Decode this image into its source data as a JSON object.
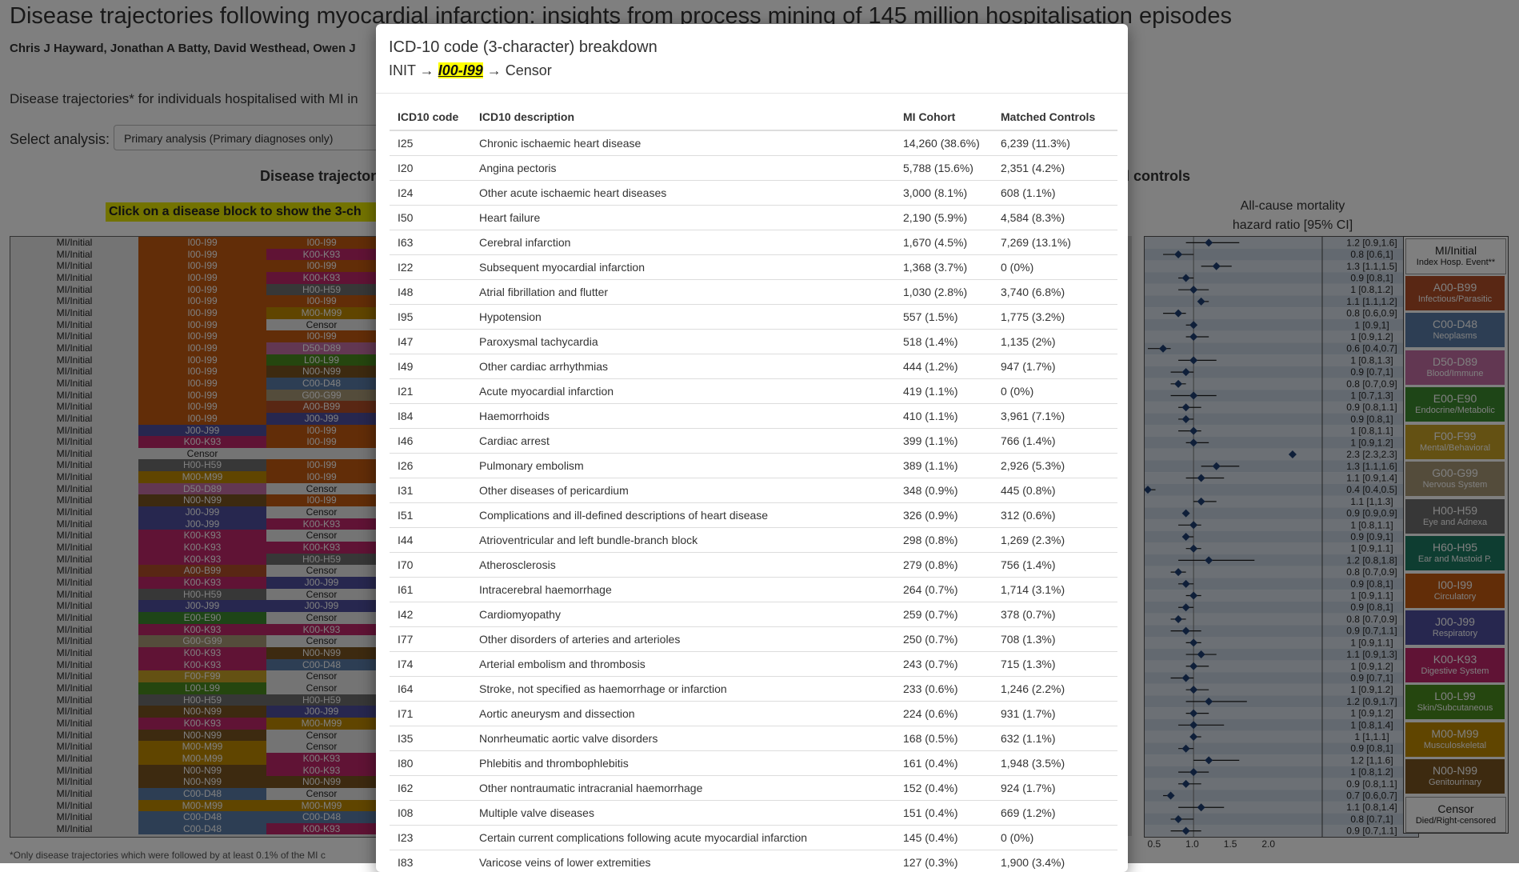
{
  "page": {
    "title": "Disease trajectories following myocardial infarction: insights from process mining of 145 million hospitalisation episodes",
    "authors": "Chris J Hayward, Jonathan A Batty, David Westhead, Owen J",
    "intro": "Disease trajectories* for individuals hospitalised with MI in",
    "select_label": "Select analysis:",
    "select_value": "Primary analysis (Primary diagnoses only)",
    "section_left": "Disease trajector",
    "section_right": "ched controls",
    "click_banner": "Click on a disease block to show the 3-ch",
    "footnote": "*Only disease trajectories which were followed by at least 0.1% of the MI c",
    "hr_title_line1": "All-cause mortality",
    "hr_title_line2": "hazard ratio [95% CI]",
    "axis_ticks": [
      "0.5",
      "1.0",
      "1.5",
      "2.0"
    ]
  },
  "colors": {
    "A00-B99": "#b34f28",
    "C00-D48": "#5a7ca8",
    "D50-D89": "#c46fa4",
    "E00-E90": "#3c8a2e",
    "F00-F99": "#c9a326",
    "G00-G99": "#a89877",
    "H00-H59": "#6e6e6e",
    "H60-H95": "#1d7a63",
    "I00-I99": "#c55a11",
    "J00-J99": "#4f4f9e",
    "K00-K93": "#c0266a",
    "L00-L99": "#4b8c1f",
    "M00-M99": "#c08a00",
    "N00-N99": "#7a5520",
    "Censor": "#e8e8e8"
  },
  "trajectories": [
    [
      "MI/Initial",
      "I00-I99",
      "I00-I99"
    ],
    [
      "MI/Initial",
      "I00-I99",
      "K00-K93"
    ],
    [
      "MI/Initial",
      "I00-I99",
      "I00-I99"
    ],
    [
      "MI/Initial",
      "I00-I99",
      "K00-K93"
    ],
    [
      "MI/Initial",
      "I00-I99",
      "H00-H59"
    ],
    [
      "MI/Initial",
      "I00-I99",
      "I00-I99"
    ],
    [
      "MI/Initial",
      "I00-I99",
      "M00-M99"
    ],
    [
      "MI/Initial",
      "I00-I99",
      "Censor"
    ],
    [
      "MI/Initial",
      "I00-I99",
      "I00-I99"
    ],
    [
      "MI/Initial",
      "I00-I99",
      "D50-D89"
    ],
    [
      "MI/Initial",
      "I00-I99",
      "L00-L99"
    ],
    [
      "MI/Initial",
      "I00-I99",
      "N00-N99"
    ],
    [
      "MI/Initial",
      "I00-I99",
      "C00-D48"
    ],
    [
      "MI/Initial",
      "I00-I99",
      "G00-G99"
    ],
    [
      "MI/Initial",
      "I00-I99",
      "A00-B99"
    ],
    [
      "MI/Initial",
      "I00-I99",
      "J00-J99"
    ],
    [
      "MI/Initial",
      "J00-J99",
      "I00-I99"
    ],
    [
      "MI/Initial",
      "K00-K93",
      "I00-I99"
    ],
    [
      "MI/Initial",
      "Censor",
      ""
    ],
    [
      "MI/Initial",
      "H00-H59",
      "I00-I99"
    ],
    [
      "MI/Initial",
      "M00-M99",
      "I00-I99"
    ],
    [
      "MI/Initial",
      "D50-D89",
      "Censor"
    ],
    [
      "MI/Initial",
      "N00-N99",
      "I00-I99"
    ],
    [
      "MI/Initial",
      "J00-J99",
      "Censor"
    ],
    [
      "MI/Initial",
      "J00-J99",
      "K00-K93"
    ],
    [
      "MI/Initial",
      "K00-K93",
      "Censor"
    ],
    [
      "MI/Initial",
      "K00-K93",
      "K00-K93"
    ],
    [
      "MI/Initial",
      "K00-K93",
      "H00-H59"
    ],
    [
      "MI/Initial",
      "A00-B99",
      "Censor"
    ],
    [
      "MI/Initial",
      "K00-K93",
      "J00-J99"
    ],
    [
      "MI/Initial",
      "H00-H59",
      "Censor"
    ],
    [
      "MI/Initial",
      "J00-J99",
      "J00-J99"
    ],
    [
      "MI/Initial",
      "E00-E90",
      "Censor"
    ],
    [
      "MI/Initial",
      "K00-K93",
      "K00-K93"
    ],
    [
      "MI/Initial",
      "G00-G99",
      "Censor"
    ],
    [
      "MI/Initial",
      "K00-K93",
      "N00-N99"
    ],
    [
      "MI/Initial",
      "K00-K93",
      "C00-D48"
    ],
    [
      "MI/Initial",
      "F00-F99",
      "Censor"
    ],
    [
      "MI/Initial",
      "L00-L99",
      "Censor"
    ],
    [
      "MI/Initial",
      "H00-H59",
      "H00-H59"
    ],
    [
      "MI/Initial",
      "N00-N99",
      "J00-J99"
    ],
    [
      "MI/Initial",
      "K00-K93",
      "M00-M99"
    ],
    [
      "MI/Initial",
      "N00-N99",
      "Censor"
    ],
    [
      "MI/Initial",
      "M00-M99",
      "Censor"
    ],
    [
      "MI/Initial",
      "M00-M99",
      "K00-K93"
    ],
    [
      "MI/Initial",
      "N00-N99",
      "K00-K93"
    ],
    [
      "MI/Initial",
      "N00-N99",
      "N00-N99"
    ],
    [
      "MI/Initial",
      "C00-D48",
      "Censor"
    ],
    [
      "MI/Initial",
      "M00-M99",
      "M00-M99"
    ],
    [
      "MI/Initial",
      "C00-D48",
      "C00-D48"
    ],
    [
      "MI/Initial",
      "C00-D48",
      "K00-K93"
    ]
  ],
  "hazard_ratios": [
    {
      "label": "1.2 [0.9,1.6]",
      "est": 1.2,
      "lo": 0.9,
      "hi": 1.6
    },
    {
      "label": "0.8 [0.6,1]",
      "est": 0.8,
      "lo": 0.6,
      "hi": 1.0
    },
    {
      "label": "1.3 [1.1,1.5]",
      "est": 1.3,
      "lo": 1.1,
      "hi": 1.5
    },
    {
      "label": "0.9 [0.8,1]",
      "est": 0.9,
      "lo": 0.8,
      "hi": 1.0
    },
    {
      "label": "1 [0.8,1.2]",
      "est": 1.0,
      "lo": 0.8,
      "hi": 1.2
    },
    {
      "label": "1.1 [1.1,1.2]",
      "est": 1.1,
      "lo": 1.1,
      "hi": 1.2
    },
    {
      "label": "0.8 [0.6,0.9]",
      "est": 0.8,
      "lo": 0.6,
      "hi": 0.9
    },
    {
      "label": "1 [0.9,1]",
      "est": 1.0,
      "lo": 0.9,
      "hi": 1.0
    },
    {
      "label": "1 [0.9,1.2]",
      "est": 1.0,
      "lo": 0.9,
      "hi": 1.2
    },
    {
      "label": "0.6 [0.4,0.7]",
      "est": 0.6,
      "lo": 0.4,
      "hi": 0.7
    },
    {
      "label": "1 [0.8,1.3]",
      "est": 1.0,
      "lo": 0.8,
      "hi": 1.3
    },
    {
      "label": "0.9 [0.7,1]",
      "est": 0.9,
      "lo": 0.7,
      "hi": 1.0
    },
    {
      "label": "0.8 [0.7,0.9]",
      "est": 0.8,
      "lo": 0.7,
      "hi": 0.9
    },
    {
      "label": "1 [0.7,1.3]",
      "est": 1.0,
      "lo": 0.7,
      "hi": 1.3
    },
    {
      "label": "0.9 [0.8,1.1]",
      "est": 0.9,
      "lo": 0.8,
      "hi": 1.1
    },
    {
      "label": "0.9 [0.8,1]",
      "est": 0.9,
      "lo": 0.8,
      "hi": 1.0
    },
    {
      "label": "1 [0.8,1.1]",
      "est": 1.0,
      "lo": 0.8,
      "hi": 1.1
    },
    {
      "label": "1 [0.9,1.2]",
      "est": 1.0,
      "lo": 0.9,
      "hi": 1.2
    },
    {
      "label": "2.3 [2.3,2.3]",
      "est": 2.3,
      "lo": 2.3,
      "hi": 2.3
    },
    {
      "label": "1.3 [1.1,1.6]",
      "est": 1.3,
      "lo": 1.1,
      "hi": 1.6
    },
    {
      "label": "1.1 [0.9,1.4]",
      "est": 1.1,
      "lo": 0.9,
      "hi": 1.4
    },
    {
      "label": "0.4 [0.4,0.5]",
      "est": 0.4,
      "lo": 0.4,
      "hi": 0.5
    },
    {
      "label": "1.1 [1,1.3]",
      "est": 1.1,
      "lo": 1.0,
      "hi": 1.3
    },
    {
      "label": "0.9 [0.9,0.9]",
      "est": 0.9,
      "lo": 0.9,
      "hi": 0.9
    },
    {
      "label": "1 [0.8,1.1]",
      "est": 1.0,
      "lo": 0.8,
      "hi": 1.1
    },
    {
      "label": "0.9 [0.9,1]",
      "est": 0.9,
      "lo": 0.9,
      "hi": 1.0
    },
    {
      "label": "1 [0.9,1.1]",
      "est": 1.0,
      "lo": 0.9,
      "hi": 1.1
    },
    {
      "label": "1.2 [0.8,1.8]",
      "est": 1.2,
      "lo": 0.8,
      "hi": 1.8
    },
    {
      "label": "0.8 [0.7,0.9]",
      "est": 0.8,
      "lo": 0.7,
      "hi": 0.9
    },
    {
      "label": "0.9 [0.8,1]",
      "est": 0.9,
      "lo": 0.8,
      "hi": 1.0
    },
    {
      "label": "1 [0.9,1.1]",
      "est": 1.0,
      "lo": 0.9,
      "hi": 1.1
    },
    {
      "label": "0.9 [0.8,1]",
      "est": 0.9,
      "lo": 0.8,
      "hi": 1.0
    },
    {
      "label": "0.8 [0.7,0.9]",
      "est": 0.8,
      "lo": 0.7,
      "hi": 0.9
    },
    {
      "label": "0.9 [0.7,1.1]",
      "est": 0.9,
      "lo": 0.7,
      "hi": 1.1
    },
    {
      "label": "1 [0.9,1.1]",
      "est": 1.0,
      "lo": 0.9,
      "hi": 1.1
    },
    {
      "label": "1.1 [0.9,1.3]",
      "est": 1.1,
      "lo": 0.9,
      "hi": 1.3
    },
    {
      "label": "1 [0.9,1.2]",
      "est": 1.0,
      "lo": 0.9,
      "hi": 1.2
    },
    {
      "label": "0.9 [0.7,1]",
      "est": 0.9,
      "lo": 0.7,
      "hi": 1.0
    },
    {
      "label": "1 [0.9,1.2]",
      "est": 1.0,
      "lo": 0.9,
      "hi": 1.2
    },
    {
      "label": "1.2 [0.9,1.7]",
      "est": 1.2,
      "lo": 0.9,
      "hi": 1.7
    },
    {
      "label": "1 [0.9,1.2]",
      "est": 1.0,
      "lo": 0.9,
      "hi": 1.2
    },
    {
      "label": "1 [0.8,1.4]",
      "est": 1.0,
      "lo": 0.8,
      "hi": 1.4
    },
    {
      "label": "1 [1,1.1]",
      "est": 1.0,
      "lo": 1.0,
      "hi": 1.1
    },
    {
      "label": "0.9 [0.8,1]",
      "est": 0.9,
      "lo": 0.8,
      "hi": 1.0
    },
    {
      "label": "1.2 [1,1.6]",
      "est": 1.2,
      "lo": 1.0,
      "hi": 1.6
    },
    {
      "label": "1 [0.8,1.2]",
      "est": 1.0,
      "lo": 0.8,
      "hi": 1.2
    },
    {
      "label": "0.9 [0.8,1.1]",
      "est": 0.9,
      "lo": 0.8,
      "hi": 1.1
    },
    {
      "label": "0.7 [0.6,0.7]",
      "est": 0.7,
      "lo": 0.6,
      "hi": 0.7
    },
    {
      "label": "1.1 [0.8,1.4]",
      "est": 1.1,
      "lo": 0.8,
      "hi": 1.4
    },
    {
      "label": "0.8 [0.7,1]",
      "est": 0.8,
      "lo": 0.7,
      "hi": 1.0
    },
    {
      "label": "0.9 [0.7,1.1]",
      "est": 0.9,
      "lo": 0.7,
      "hi": 1.1
    }
  ],
  "legend": [
    {
      "code": "MI/Initial",
      "desc": "Index Hosp. Event**",
      "color": "#ffffff",
      "fg": "#222"
    },
    {
      "code": "A00-B99",
      "desc": "Infectious/Parasitic",
      "color": "#b34f28",
      "fg": "#fff"
    },
    {
      "code": "C00-D48",
      "desc": "Neoplasms",
      "color": "#5a7ca8",
      "fg": "#fff"
    },
    {
      "code": "D50-D89",
      "desc": "Blood/Immune",
      "color": "#c46fa4",
      "fg": "#fff"
    },
    {
      "code": "E00-E90",
      "desc": "Endocrine/Metabolic",
      "color": "#3c8a2e",
      "fg": "#fff"
    },
    {
      "code": "F00-F99",
      "desc": "Mental/Behavioral",
      "color": "#c9a326",
      "fg": "#fff"
    },
    {
      "code": "G00-G99",
      "desc": "Nervous System",
      "color": "#a89877",
      "fg": "#fff"
    },
    {
      "code": "H00-H59",
      "desc": "Eye and Adnexa",
      "color": "#6e6e6e",
      "fg": "#fff"
    },
    {
      "code": "H60-H95",
      "desc": "Ear and Mastoid P.",
      "color": "#1d7a63",
      "fg": "#fff"
    },
    {
      "code": "I00-I99",
      "desc": "Circulatory",
      "color": "#c55a11",
      "fg": "#fff"
    },
    {
      "code": "J00-J99",
      "desc": "Respiratory",
      "color": "#4f4f9e",
      "fg": "#fff"
    },
    {
      "code": "K00-K93",
      "desc": "Digestive System",
      "color": "#c0266a",
      "fg": "#fff"
    },
    {
      "code": "L00-L99",
      "desc": "Skin/Subcutaneous",
      "color": "#4b8c1f",
      "fg": "#fff"
    },
    {
      "code": "M00-M99",
      "desc": "Musculoskeletal",
      "color": "#c08a00",
      "fg": "#fff"
    },
    {
      "code": "N00-N99",
      "desc": "Genitourinary",
      "color": "#7a5520",
      "fg": "#fff"
    },
    {
      "code": "Censor",
      "desc": "Died/Right-censored",
      "color": "#ffffff",
      "fg": "#222"
    }
  ],
  "modal": {
    "title": "ICD-10 code (3-character) breakdown",
    "path_prefix": "INIT → ",
    "path_highlight": "I00-I99",
    "path_suffix": " → Censor",
    "columns": [
      "ICD10 code",
      "ICD10 description",
      "MI Cohort",
      "Matched Controls"
    ],
    "rows": [
      [
        "I25",
        "Chronic ischaemic heart disease",
        "14,260 (38.6%)",
        "6,239 (11.3%)"
      ],
      [
        "I20",
        "Angina pectoris",
        "5,788 (15.6%)",
        "2,351 (4.2%)"
      ],
      [
        "I24",
        "Other acute ischaemic heart diseases",
        "3,000 (8.1%)",
        "608 (1.1%)"
      ],
      [
        "I50",
        "Heart failure",
        "2,190 (5.9%)",
        "4,584 (8.3%)"
      ],
      [
        "I63",
        "Cerebral infarction",
        "1,670 (4.5%)",
        "7,269 (13.1%)"
      ],
      [
        "I22",
        "Subsequent myocardial infarction",
        "1,368 (3.7%)",
        "0 (0%)"
      ],
      [
        "I48",
        "Atrial fibrillation and flutter",
        "1,030 (2.8%)",
        "3,740 (6.8%)"
      ],
      [
        "I95",
        "Hypotension",
        "557 (1.5%)",
        "1,775 (3.2%)"
      ],
      [
        "I47",
        "Paroxysmal tachycardia",
        "518 (1.4%)",
        "1,135 (2%)"
      ],
      [
        "I49",
        "Other cardiac arrhythmias",
        "444 (1.2%)",
        "947 (1.7%)"
      ],
      [
        "I21",
        "Acute myocardial infarction",
        "419 (1.1%)",
        "0 (0%)"
      ],
      [
        "I84",
        "Haemorrhoids",
        "410 (1.1%)",
        "3,961 (7.1%)"
      ],
      [
        "I46",
        "Cardiac arrest",
        "399 (1.1%)",
        "766 (1.4%)"
      ],
      [
        "I26",
        "Pulmonary embolism",
        "389 (1.1%)",
        "2,926 (5.3%)"
      ],
      [
        "I31",
        "Other diseases of pericardium",
        "348 (0.9%)",
        "445 (0.8%)"
      ],
      [
        "I51",
        "Complications and ill-defined descriptions of heart disease",
        "326 (0.9%)",
        "312 (0.6%)"
      ],
      [
        "I44",
        "Atrioventricular and left bundle-branch block",
        "298 (0.8%)",
        "1,269 (2.3%)"
      ],
      [
        "I70",
        "Atherosclerosis",
        "279 (0.8%)",
        "756 (1.4%)"
      ],
      [
        "I61",
        "Intracerebral haemorrhage",
        "264 (0.7%)",
        "1,714 (3.1%)"
      ],
      [
        "I42",
        "Cardiomyopathy",
        "259 (0.7%)",
        "378 (0.7%)"
      ],
      [
        "I77",
        "Other disorders of arteries and arterioles",
        "250 (0.7%)",
        "708 (1.3%)"
      ],
      [
        "I74",
        "Arterial embolism and thrombosis",
        "243 (0.7%)",
        "715 (1.3%)"
      ],
      [
        "I64",
        "Stroke, not specified as haemorrhage or infarction",
        "233 (0.6%)",
        "1,246 (2.2%)"
      ],
      [
        "I71",
        "Aortic aneurysm and dissection",
        "224 (0.6%)",
        "931 (1.7%)"
      ],
      [
        "I35",
        "Nonrheumatic aortic valve disorders",
        "168 (0.5%)",
        "632 (1.1%)"
      ],
      [
        "I80",
        "Phlebitis and thrombophlebitis",
        "161 (0.4%)",
        "1,948 (3.5%)"
      ],
      [
        "I62",
        "Other nontraumatic intracranial haemorrhage",
        "152 (0.4%)",
        "924 (1.7%)"
      ],
      [
        "I08",
        "Multiple valve diseases",
        "151 (0.4%)",
        "669 (1.2%)"
      ],
      [
        "I23",
        "Certain current complications following acute myocardial infarction",
        "145 (0.4%)",
        "0 (0%)"
      ],
      [
        "I83",
        "Varicose veins of lower extremities",
        "127 (0.3%)",
        "1,900 (3.4%)"
      ]
    ]
  }
}
